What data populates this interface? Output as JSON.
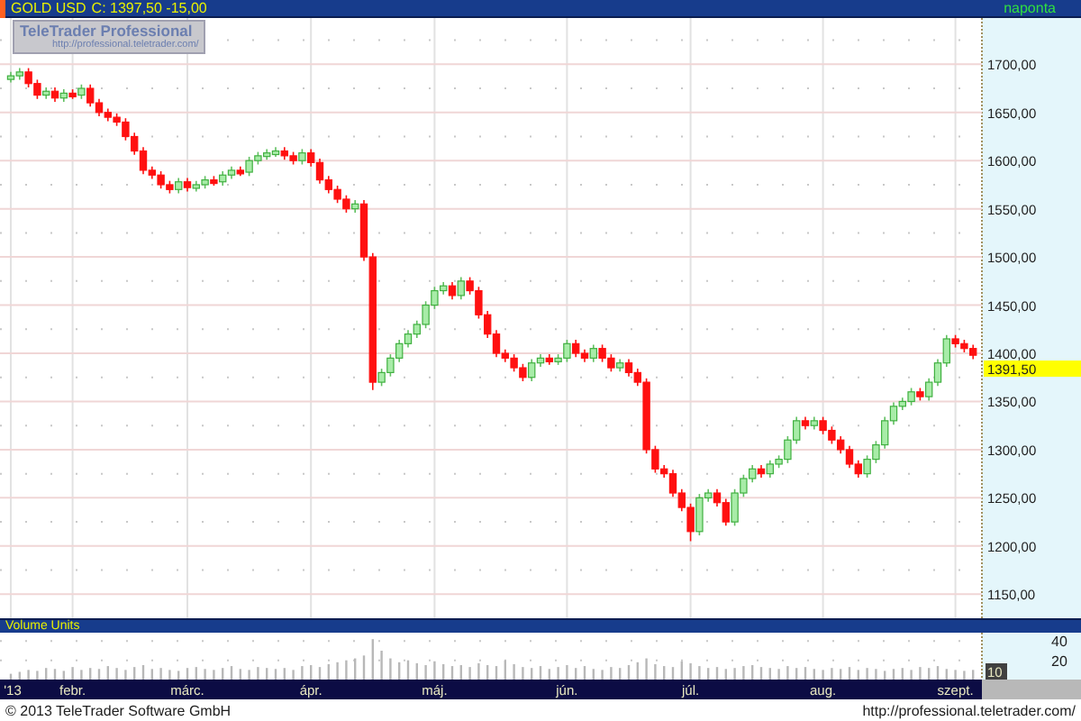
{
  "header": {
    "quote": "C: 1397,50 -15,00",
    "period": "naponta"
  },
  "logo": {
    "title": "TeleTrader Professional",
    "url": "http://professional.teletrader.com/"
  },
  "price_chart": {
    "chart_data": {
      "type": "candlestick",
      "grid": true,
      "ylim": [
        1125,
        1748
      ],
      "yticks": [
        {
          "value": 1150,
          "label": "1150,00"
        },
        {
          "value": 1200,
          "label": "1200,00"
        },
        {
          "value": 1250,
          "label": "1250,00"
        },
        {
          "value": 1300,
          "label": "1300,00"
        },
        {
          "value": 1350,
          "label": "1350,00"
        },
        {
          "value": 1400,
          "label": "1400,00"
        },
        {
          "value": 1450,
          "label": "1450,00"
        },
        {
          "value": 1500,
          "label": "1500,00"
        },
        {
          "value": 1550,
          "label": "1550,00"
        },
        {
          "value": 1600,
          "label": "1600,00"
        },
        {
          "value": 1650,
          "label": "1650,00"
        },
        {
          "value": 1700,
          "label": "1700,00"
        }
      ],
      "categories": [
        null,
        null,
        null,
        null,
        null,
        null,
        null,
        null,
        null,
        null,
        null,
        null,
        null,
        null,
        null,
        null,
        null,
        null,
        null,
        null,
        null,
        null,
        null,
        null,
        null,
        null,
        null,
        null,
        null,
        null,
        null,
        null,
        null,
        null,
        null,
        null,
        null,
        null,
        null,
        null,
        null,
        null,
        null,
        null,
        null,
        null,
        null,
        null,
        null,
        null,
        null,
        null,
        null,
        null,
        null,
        null,
        null,
        null,
        null,
        null,
        null,
        null,
        null,
        null,
        null,
        null,
        null,
        null,
        null,
        null,
        null,
        null,
        null,
        null,
        null,
        null,
        null,
        null,
        null,
        null,
        null,
        null,
        null,
        null,
        null,
        null,
        null,
        null,
        null,
        null,
        null,
        null,
        null,
        null,
        null,
        null,
        null,
        null,
        null,
        null,
        null,
        null,
        null,
        null,
        null,
        null,
        null,
        null,
        null,
        null
      ],
      "series": [
        {
          "name": "GOLD USD",
          "ohlc": [
            [
              1685,
              1692,
              1681,
              1688
            ],
            [
              1688,
              1696,
              1684,
              1692
            ],
            [
              1692,
              1696,
              1676,
              1680
            ],
            [
              1680,
              1684,
              1664,
              1668
            ],
            [
              1668,
              1676,
              1664,
              1672
            ],
            [
              1672,
              1676,
              1661,
              1665
            ],
            [
              1665,
              1674,
              1661,
              1670
            ],
            [
              1670,
              1674,
              1664,
              1668
            ],
            [
              1668,
              1679,
              1664,
              1675
            ],
            [
              1675,
              1679,
              1656,
              1660
            ],
            [
              1660,
              1664,
              1646,
              1650
            ],
            [
              1650,
              1654,
              1641,
              1645
            ],
            [
              1645,
              1649,
              1636,
              1640
            ],
            [
              1640,
              1644,
              1621,
              1625
            ],
            [
              1625,
              1629,
              1606,
              1610
            ],
            [
              1610,
              1614,
              1586,
              1590
            ],
            [
              1590,
              1594,
              1581,
              1585
            ],
            [
              1585,
              1589,
              1571,
              1575
            ],
            [
              1575,
              1579,
              1566,
              1570
            ],
            [
              1570,
              1582,
              1566,
              1578
            ],
            [
              1578,
              1582,
              1568,
              1572
            ],
            [
              1572,
              1579,
              1568,
              1575
            ],
            [
              1575,
              1584,
              1571,
              1580
            ],
            [
              1580,
              1584,
              1574,
              1578
            ],
            [
              1578,
              1589,
              1574,
              1585
            ],
            [
              1585,
              1594,
              1581,
              1590
            ],
            [
              1590,
              1594,
              1584,
              1588
            ],
            [
              1588,
              1604,
              1584,
              1600
            ],
            [
              1600,
              1609,
              1596,
              1605
            ],
            [
              1605,
              1612,
              1601,
              1608
            ],
            [
              1608,
              1614,
              1604,
              1610
            ],
            [
              1610,
              1614,
              1601,
              1605
            ],
            [
              1605,
              1609,
              1596,
              1600
            ],
            [
              1600,
              1612,
              1596,
              1608
            ],
            [
              1608,
              1612,
              1594,
              1598
            ],
            [
              1598,
              1602,
              1576,
              1580
            ],
            [
              1580,
              1584,
              1566,
              1570
            ],
            [
              1570,
              1574,
              1556,
              1560
            ],
            [
              1560,
              1564,
              1546,
              1550
            ],
            [
              1550,
              1559,
              1546,
              1555
            ],
            [
              1555,
              1559,
              1496,
              1500
            ],
            [
              1500,
              1504,
              1362,
              1370
            ],
            [
              1370,
              1384,
              1366,
              1380
            ],
            [
              1380,
              1399,
              1376,
              1395
            ],
            [
              1395,
              1414,
              1391,
              1410
            ],
            [
              1410,
              1424,
              1406,
              1420
            ],
            [
              1420,
              1434,
              1416,
              1430
            ],
            [
              1430,
              1454,
              1426,
              1450
            ],
            [
              1450,
              1469,
              1446,
              1465
            ],
            [
              1465,
              1474,
              1461,
              1470
            ],
            [
              1470,
              1474,
              1456,
              1460
            ],
            [
              1460,
              1479,
              1456,
              1475
            ],
            [
              1475,
              1479,
              1461,
              1465
            ],
            [
              1465,
              1469,
              1436,
              1440
            ],
            [
              1440,
              1444,
              1416,
              1420
            ],
            [
              1420,
              1424,
              1396,
              1400
            ],
            [
              1400,
              1404,
              1391,
              1395
            ],
            [
              1395,
              1399,
              1381,
              1385
            ],
            [
              1385,
              1389,
              1371,
              1375
            ],
            [
              1375,
              1394,
              1371,
              1390
            ],
            [
              1390,
              1399,
              1386,
              1395
            ],
            [
              1395,
              1399,
              1388,
              1392
            ],
            [
              1392,
              1399,
              1388,
              1395
            ],
            [
              1395,
              1414,
              1391,
              1410
            ],
            [
              1410,
              1414,
              1396,
              1400
            ],
            [
              1400,
              1404,
              1391,
              1395
            ],
            [
              1395,
              1409,
              1391,
              1405
            ],
            [
              1405,
              1409,
              1391,
              1395
            ],
            [
              1395,
              1399,
              1381,
              1385
            ],
            [
              1385,
              1394,
              1381,
              1390
            ],
            [
              1390,
              1394,
              1376,
              1380
            ],
            [
              1380,
              1384,
              1366,
              1370
            ],
            [
              1370,
              1374,
              1296,
              1300
            ],
            [
              1300,
              1304,
              1276,
              1280
            ],
            [
              1280,
              1284,
              1271,
              1275
            ],
            [
              1275,
              1279,
              1251,
              1255
            ],
            [
              1255,
              1259,
              1236,
              1240
            ],
            [
              1240,
              1244,
              1205,
              1215
            ],
            [
              1215,
              1254,
              1211,
              1250
            ],
            [
              1250,
              1259,
              1246,
              1255
            ],
            [
              1255,
              1259,
              1241,
              1245
            ],
            [
              1245,
              1249,
              1221,
              1225
            ],
            [
              1225,
              1259,
              1221,
              1255
            ],
            [
              1255,
              1274,
              1251,
              1270
            ],
            [
              1270,
              1284,
              1266,
              1280
            ],
            [
              1280,
              1284,
              1271,
              1275
            ],
            [
              1275,
              1289,
              1271,
              1285
            ],
            [
              1285,
              1294,
              1281,
              1290
            ],
            [
              1290,
              1314,
              1286,
              1310
            ],
            [
              1310,
              1334,
              1306,
              1330
            ],
            [
              1330,
              1334,
              1321,
              1325
            ],
            [
              1325,
              1334,
              1321,
              1330
            ],
            [
              1330,
              1334,
              1316,
              1320
            ],
            [
              1320,
              1324,
              1306,
              1310
            ],
            [
              1310,
              1314,
              1296,
              1300
            ],
            [
              1300,
              1304,
              1281,
              1285
            ],
            [
              1285,
              1289,
              1271,
              1275
            ],
            [
              1275,
              1294,
              1271,
              1290
            ],
            [
              1290,
              1309,
              1286,
              1305
            ],
            [
              1305,
              1334,
              1301,
              1330
            ],
            [
              1330,
              1349,
              1326,
              1345
            ],
            [
              1345,
              1354,
              1341,
              1350
            ],
            [
              1350,
              1364,
              1346,
              1360
            ],
            [
              1360,
              1364,
              1351,
              1355
            ],
            [
              1355,
              1374,
              1351,
              1370
            ],
            [
              1370,
              1394,
              1366,
              1390
            ],
            [
              1390,
              1419,
              1386,
              1415
            ],
            [
              1415,
              1419,
              1406,
              1410
            ],
            [
              1410,
              1414,
              1401,
              1405
            ],
            [
              1405,
              1409,
              1394,
              1398
            ]
          ]
        }
      ]
    },
    "current_price": "1391,50"
  },
  "volume": {
    "current": "10",
    "chart_data": {
      "type": "bar",
      "ylim": [
        0,
        45
      ],
      "yticks": [
        {
          "value": 20,
          "label": "20"
        },
        {
          "value": 40,
          "label": "40"
        }
      ],
      "categories": [
        "'13",
        null,
        null,
        null,
        null,
        null,
        null,
        "febr.",
        null,
        null,
        null,
        null,
        null,
        null,
        null,
        null,
        null,
        null,
        null,
        null,
        "márc.",
        null,
        null,
        null,
        null,
        null,
        null,
        null,
        null,
        null,
        null,
        null,
        null,
        null,
        "ápr.",
        null,
        null,
        null,
        null,
        null,
        null,
        null,
        null,
        null,
        null,
        null,
        null,
        null,
        "máj.",
        null,
        null,
        null,
        null,
        null,
        null,
        null,
        null,
        null,
        null,
        null,
        null,
        null,
        null,
        "jún.",
        null,
        null,
        null,
        null,
        null,
        null,
        null,
        null,
        null,
        null,
        null,
        null,
        null,
        "júl.",
        null,
        null,
        null,
        null,
        null,
        null,
        null,
        null,
        null,
        null,
        null,
        null,
        null,
        null,
        "aug.",
        null,
        null,
        null,
        null,
        null,
        null,
        null,
        null,
        null,
        null,
        null,
        null,
        null,
        null,
        "szept.",
        null,
        null
      ],
      "series": [
        {
          "name": "Volume Units",
          "color": "#b8b8b8",
          "values": [
            6,
            8,
            10,
            9,
            12,
            11,
            9,
            13,
            10,
            12,
            11,
            14,
            12,
            10,
            13,
            15,
            11,
            12,
            10,
            9,
            12,
            13,
            11,
            10,
            12,
            14,
            11,
            10,
            13,
            12,
            11,
            12,
            10,
            14,
            15,
            13,
            16,
            18,
            20,
            22,
            25,
            42,
            30,
            22,
            18,
            20,
            17,
            15,
            19,
            16,
            14,
            15,
            13,
            17,
            15,
            14,
            20,
            16,
            13,
            12,
            14,
            11,
            13,
            15,
            12,
            14,
            11,
            10,
            13,
            12,
            15,
            18,
            22,
            16,
            14,
            13,
            19,
            17,
            14,
            12,
            13,
            11,
            12,
            14,
            15,
            13,
            12,
            11,
            14,
            12,
            13,
            11,
            10,
            12,
            11,
            13,
            10,
            12,
            11,
            9,
            11,
            12,
            10,
            13,
            12,
            14,
            11,
            10,
            9,
            10
          ]
        }
      ]
    }
  },
  "footer": {
    "copyright": "© 2013 TeleTrader Software GmbH",
    "url": "http://professional.teletrader.com/"
  }
}
